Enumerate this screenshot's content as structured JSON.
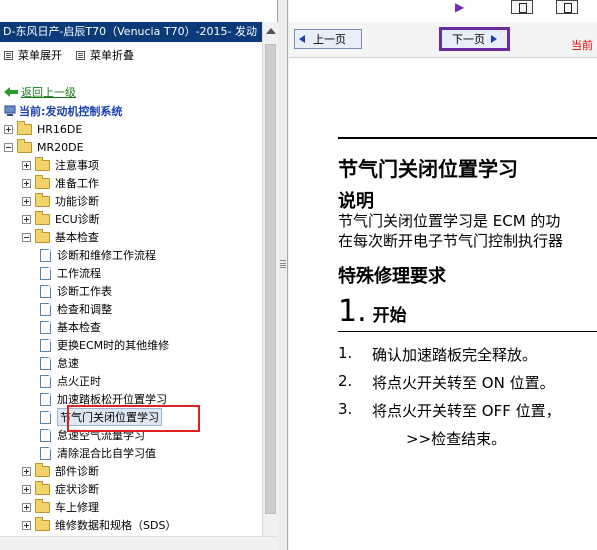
{
  "left_pane": {
    "title": "D-东风日产-启辰T70（Venucia T70）-2015- 发动",
    "toolbar": {
      "expand_label": "菜单展开",
      "collapse_label": "菜单折叠"
    },
    "back_label": "返回上一级",
    "current_label": "当前:发动机控制系统",
    "tree": [
      {
        "label": "HR16DE",
        "kind": "folder",
        "expanded": false
      },
      {
        "label": "MR20DE",
        "kind": "folder",
        "expanded": true
      },
      {
        "label": "注意事项",
        "kind": "folder",
        "expanded": false
      },
      {
        "label": "准备工作",
        "kind": "folder",
        "expanded": false
      },
      {
        "label": "功能诊断",
        "kind": "folder",
        "expanded": false
      },
      {
        "label": "ECU诊断",
        "kind": "folder",
        "expanded": false
      },
      {
        "label": "基本检查",
        "kind": "folder",
        "expanded": true
      },
      {
        "label": "诊断和维修工作流程",
        "kind": "doc"
      },
      {
        "label": "工作流程",
        "kind": "doc"
      },
      {
        "label": "诊断工作表",
        "kind": "doc"
      },
      {
        "label": "检查和调整",
        "kind": "doc"
      },
      {
        "label": "基本检查",
        "kind": "doc"
      },
      {
        "label": "更换ECM时的其他维修",
        "kind": "doc"
      },
      {
        "label": "怠速",
        "kind": "doc"
      },
      {
        "label": "点火正时",
        "kind": "doc"
      },
      {
        "label": "加速踏板松开位置学习",
        "kind": "doc"
      },
      {
        "label": "节气门关闭位置学习",
        "kind": "doc",
        "selected": true
      },
      {
        "label": "怠速空气流量学习",
        "kind": "doc"
      },
      {
        "label": "清除混合比自学习值",
        "kind": "doc"
      },
      {
        "label": "部件诊断",
        "kind": "folder",
        "expanded": false
      },
      {
        "label": "症状诊断",
        "kind": "folder",
        "expanded": false
      },
      {
        "label": "车上修理",
        "kind": "folder",
        "expanded": false
      },
      {
        "label": "维修数据和规格（SDS）",
        "kind": "folder",
        "expanded": false
      }
    ]
  },
  "right_pane": {
    "prev_label": "上一页",
    "next_label": "下一页",
    "current_tag": "当前",
    "content": {
      "title": "节气门关闭位置学习",
      "section_desc": "说明",
      "desc_line1": "节气门关闭位置学习是 ECM 的功",
      "desc_line2": "在每次断开电子节气门控制执行器",
      "section_special": "特殊修理要求",
      "step_number": "1.",
      "step_label": "开始",
      "items": [
        {
          "n": "1.",
          "text": "确认加速踏板完全释放。"
        },
        {
          "n": "2.",
          "text": "将点火开关转至 ON 位置。"
        },
        {
          "n": "3.",
          "text": "将点火开关转至 OFF 位置，"
        }
      ],
      "end_note": ">>检查结束。"
    }
  },
  "colors": {
    "title_bar": "#0a3a78",
    "highlight_box": "#e02020",
    "next_btn_border": "#6a2c9c",
    "link_green": "#1a7a1a",
    "current_blue": "#1a3fb0"
  }
}
